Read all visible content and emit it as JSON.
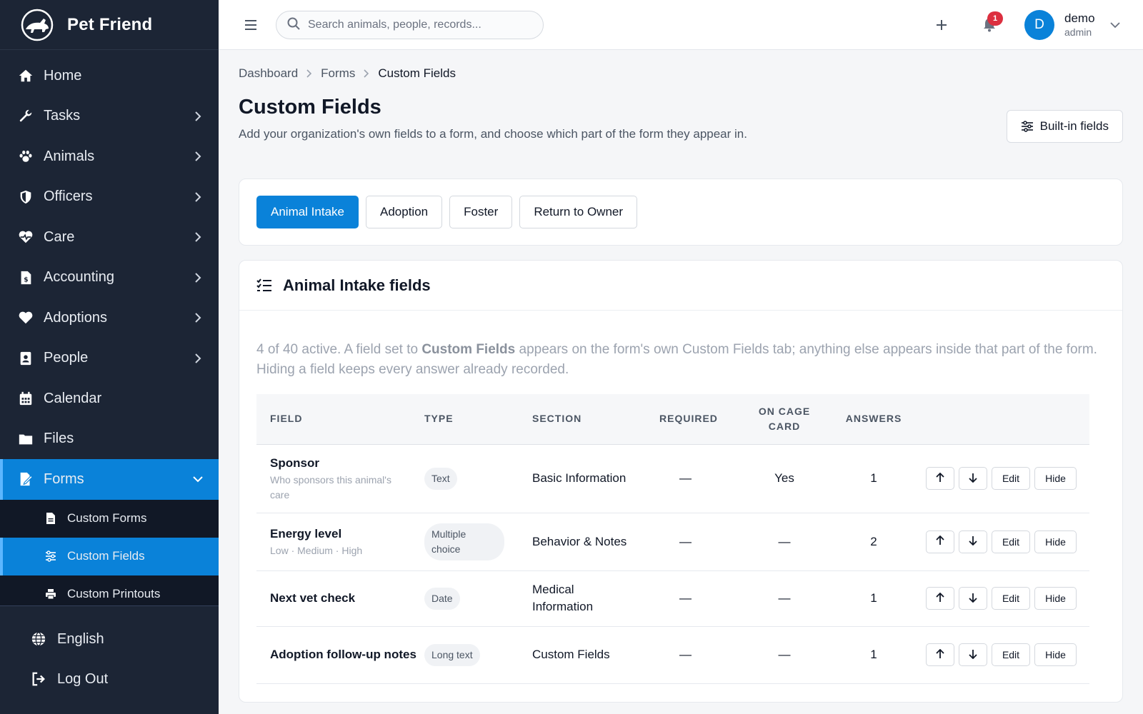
{
  "app": {
    "name": "Pet Friend"
  },
  "sidebar": {
    "items": [
      {
        "label": "Home",
        "icon": "home-icon",
        "chevron": false
      },
      {
        "label": "Tasks",
        "icon": "wrench-icon",
        "chevron": true
      },
      {
        "label": "Animals",
        "icon": "paw-icon",
        "chevron": true
      },
      {
        "label": "Officers",
        "icon": "shield-icon",
        "chevron": true
      },
      {
        "label": "Care",
        "icon": "heart-pulse-icon",
        "chevron": true
      },
      {
        "label": "Accounting",
        "icon": "invoice-icon",
        "chevron": true
      },
      {
        "label": "Adoptions",
        "icon": "heart-icon",
        "chevron": true
      },
      {
        "label": "People",
        "icon": "contact-card-icon",
        "chevron": true
      },
      {
        "label": "Calendar",
        "icon": "calendar-icon",
        "chevron": false
      },
      {
        "label": "Files",
        "icon": "folder-icon",
        "chevron": false
      },
      {
        "label": "Forms",
        "icon": "form-edit-icon",
        "chevron": "down",
        "active": true
      }
    ],
    "subitems": [
      {
        "label": "Custom Forms",
        "icon": "file-icon"
      },
      {
        "label": "Custom Fields",
        "icon": "sliders-icon",
        "active": true
      },
      {
        "label": "Custom Printouts",
        "icon": "printer-icon"
      }
    ],
    "footer": [
      {
        "label": "English",
        "icon": "globe-icon"
      },
      {
        "label": "Log Out",
        "icon": "logout-icon"
      }
    ]
  },
  "topbar": {
    "search_placeholder": "Search animals, people, records...",
    "notification_count": "1",
    "user": {
      "initial": "D",
      "name": "demo",
      "role": "admin"
    }
  },
  "breadcrumb": [
    "Dashboard",
    "Forms",
    "Custom Fields"
  ],
  "page": {
    "title": "Custom Fields",
    "subtitle": "Add your organization's own fields to a form, and choose which part of the form they appear in.",
    "builtin_button": "Built-in fields"
  },
  "tabs": [
    {
      "label": "Animal Intake",
      "active": true
    },
    {
      "label": "Adoption",
      "active": false
    },
    {
      "label": "Foster",
      "active": false
    },
    {
      "label": "Return to Owner",
      "active": false
    }
  ],
  "fields_card": {
    "title": "Animal Intake fields",
    "info_prefix": "4 of 40 active. A field set to ",
    "info_bold": "Custom Fields",
    "info_suffix": " appears on the form's own Custom Fields tab; anything else appears inside that part of the form. Hiding a field keeps every answer already recorded."
  },
  "table": {
    "headers": {
      "field": "FIELD",
      "type": "TYPE",
      "section": "SECTION",
      "required": "REQUIRED",
      "cage_line1": "ON CAGE",
      "cage_line2": "CARD",
      "answers": "ANSWERS"
    },
    "rows": [
      {
        "name": "Sponsor",
        "desc": "Who sponsors this animal's care",
        "type": "Text",
        "section": "Basic Information",
        "required": "—",
        "cage": "Yes",
        "answers": "1"
      },
      {
        "name": "Energy level",
        "desc": "Low · Medium · High",
        "type": "Multiple choice",
        "section": "Behavior & Notes",
        "required": "—",
        "cage": "—",
        "answers": "2"
      },
      {
        "name": "Next vet check",
        "desc": "",
        "type": "Date",
        "section": "Medical Information",
        "required": "—",
        "cage": "—",
        "answers": "1"
      },
      {
        "name": "Adoption follow-up notes",
        "desc": "",
        "type": "Long text",
        "section": "Custom Fields",
        "required": "—",
        "cage": "—",
        "answers": "1"
      }
    ],
    "action_labels": {
      "edit": "Edit",
      "hide": "Hide"
    }
  },
  "colors": {
    "sidebar_bg": "#1c2535",
    "accent": "#0a82d9",
    "badge": "#dc2f3f"
  }
}
